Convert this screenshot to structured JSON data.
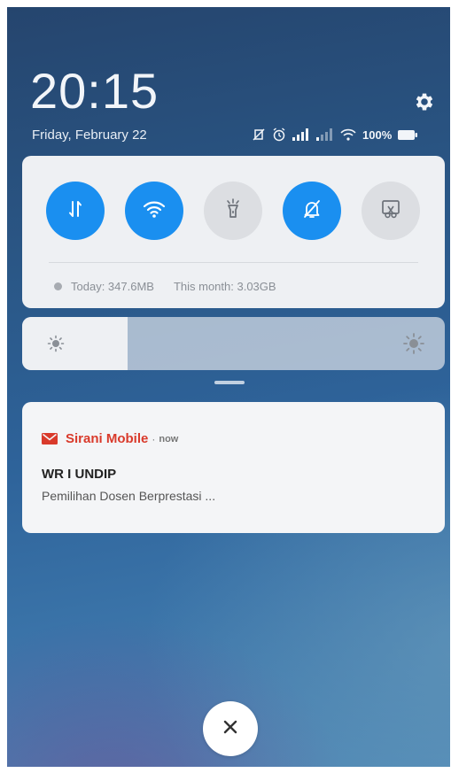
{
  "lockscreen": {
    "time": "20:15",
    "date": "Friday, February 22"
  },
  "status_bar": {
    "icons": [
      "no-vibrate-icon",
      "alarm-icon",
      "signal-icon",
      "signal-weak-icon",
      "wifi-icon",
      "battery-icon"
    ],
    "battery_percent": "100%"
  },
  "quick_settings": {
    "toggles": [
      {
        "icon": "mobile-data-icon",
        "state": "on"
      },
      {
        "icon": "wifi-icon",
        "state": "on"
      },
      {
        "icon": "flashlight-icon",
        "state": "off"
      },
      {
        "icon": "silent-mode-icon",
        "state": "on"
      },
      {
        "icon": "screenshot-icon",
        "state": "off"
      }
    ],
    "data_usage": {
      "today": "Today: 347.6MB",
      "month": "This month: 3.03GB"
    },
    "accent_color": "#1a8ff0"
  },
  "brightness": {
    "level": 0.25
  },
  "notification": {
    "app_name": "Sirani Mobile",
    "separator": "·",
    "time": "now",
    "title": "WR I UNDIP",
    "body": "Pemilihan Dosen Berprestasi ...",
    "app_color": "#d93a2b"
  },
  "actions": {
    "clear_icon": "close-icon"
  }
}
